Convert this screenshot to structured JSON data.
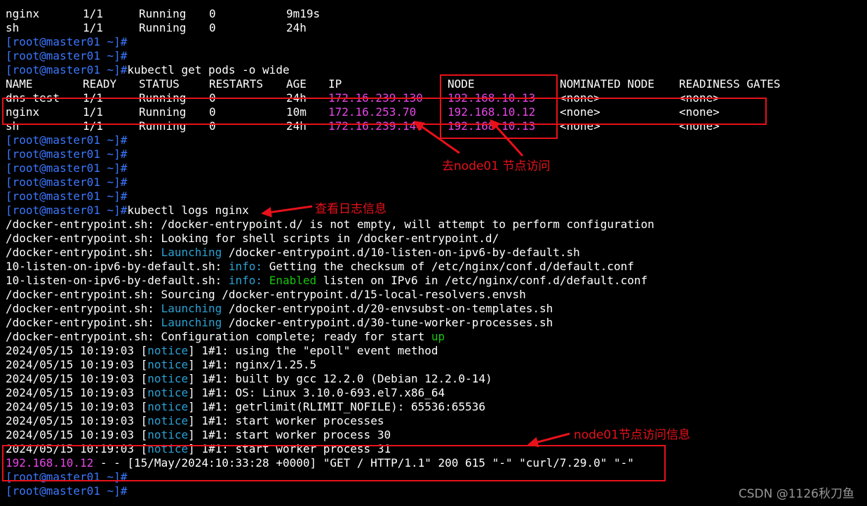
{
  "colors": {
    "background": "#000000",
    "text": "#ffffff",
    "prompt": "#3b78ff",
    "ip_highlight": "#e846e8",
    "keyword": "#2aa1d3",
    "success": "#16c60c",
    "annotation": "#e8111a"
  },
  "prompt": "[root@master01 ~]#",
  "top_rows": [
    {
      "name": "nginx",
      "ready": "1/1",
      "status": "Running",
      "restarts": "0",
      "age": "9m19s"
    },
    {
      "name": "sh",
      "ready": "1/1",
      "status": "Running",
      "restarts": "0",
      "age": "24h"
    }
  ],
  "commands": {
    "get_pods": "kubectl get pods -o wide",
    "logs": "kubectl logs nginx"
  },
  "pods_table": {
    "headers": {
      "name": "NAME",
      "ready": "READY",
      "status": "STATUS",
      "restarts": "RESTARTS",
      "age": "AGE",
      "ip": "IP",
      "node": "NODE",
      "nominated": "NOMINATED NODE",
      "readiness": "READINESS GATES"
    },
    "rows": [
      {
        "name": "dns-test",
        "ready": "1/1",
        "status": "Running",
        "restarts": "0",
        "age": "24h",
        "ip": "172.16.239.130",
        "node": "192.168.10.13",
        "nominated": "<none>",
        "readiness": "<none>"
      },
      {
        "name": "nginx",
        "ready": "1/1",
        "status": "Running",
        "restarts": "0",
        "age": "10m",
        "ip": "172.16.253.70",
        "node": "192.168.10.12",
        "nominated": "<none>",
        "readiness": "<none>"
      },
      {
        "name": "sh",
        "ready": "1/1",
        "status": "Running",
        "restarts": "0",
        "age": "24h",
        "ip": "172.16.239.144",
        "node": "192.168.10.13",
        "nominated": "<none>",
        "readiness": "<none>"
      }
    ]
  },
  "log_lines": {
    "l1": "/docker-entrypoint.sh: /docker-entrypoint.d/ is not empty, will attempt to perform configuration",
    "l2": "/docker-entrypoint.sh: Looking for shell scripts in /docker-entrypoint.d/",
    "l3_pre": "/docker-entrypoint.sh: ",
    "launching": "Launching",
    "l3_post": " /docker-entrypoint.d/10-listen-on-ipv6-by-default.sh",
    "ipv6_prefix": "10-listen-on-ipv6-by-default.sh: ",
    "info": "info:",
    "l4_post": " Getting the checksum of /etc/nginx/conf.d/default.conf",
    "enabled": "Enabled",
    "l5_post": " listen on IPv6 in /etc/nginx/conf.d/default.conf",
    "l6": "/docker-entrypoint.sh: Sourcing /docker-entrypoint.d/15-local-resolvers.envsh",
    "l7_post": " /docker-entrypoint.d/20-envsubst-on-templates.sh",
    "l8_post": " /docker-entrypoint.d/30-tune-worker-processes.sh",
    "l9_pre": "/docker-entrypoint.sh: Configuration complete; ready for start ",
    "up": "up"
  },
  "notice_lines": [
    {
      "ts": "2024/05/15 10:19:03",
      "msg": " 1#1: using the \"epoll\" event method"
    },
    {
      "ts": "2024/05/15 10:19:03",
      "msg": " 1#1: nginx/1.25.5"
    },
    {
      "ts": "2024/05/15 10:19:03",
      "msg": " 1#1: built by gcc 12.2.0 (Debian 12.2.0-14)"
    },
    {
      "ts": "2024/05/15 10:19:03",
      "msg": " 1#1: OS: Linux 3.10.0-693.el7.x86_64"
    },
    {
      "ts": "2024/05/15 10:19:03",
      "msg": " 1#1: getrlimit(RLIMIT_NOFILE): 65536:65536"
    },
    {
      "ts": "2024/05/15 10:19:03",
      "msg": " 1#1: start worker processes"
    },
    {
      "ts": "2024/05/15 10:19:03",
      "msg": " 1#1: start worker process 30"
    },
    {
      "ts": "2024/05/15 10:19:03",
      "msg": " 1#1: start worker process 31"
    }
  ],
  "notice_label": "notice",
  "access_log": {
    "ip": "192.168.10.12",
    "rest": " - - [15/May/2024:10:33:28 +0000] \"GET / HTTP/1.1\" 200 615 \"-\" \"curl/7.29.0\" \"-\""
  },
  "annotations": {
    "node_access": "去node01 节点访问",
    "view_logs": "查看日志信息",
    "access_info": "node01节点访问信息"
  },
  "watermark": "CSDN @1126秋刀鱼"
}
